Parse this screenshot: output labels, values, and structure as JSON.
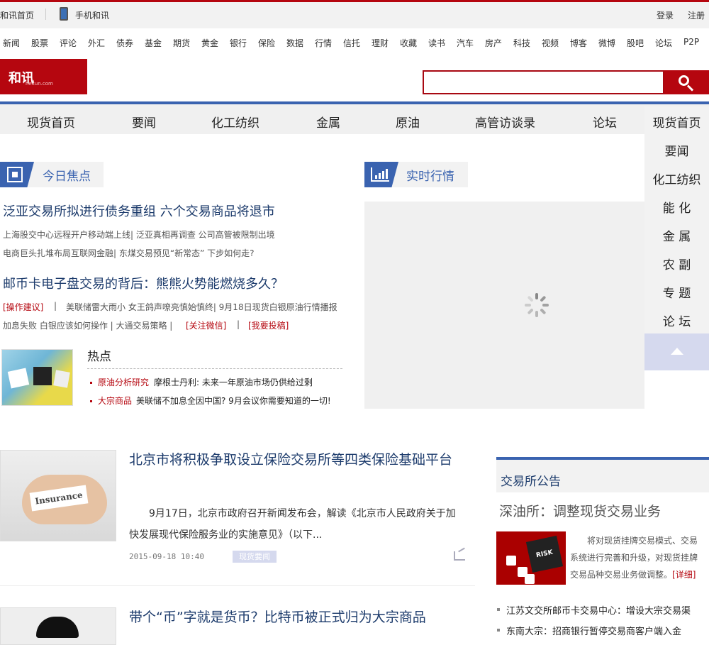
{
  "topbar": {
    "home": "和讯首页",
    "mobile": "手机和讯",
    "login": "登录",
    "register": "注册"
  },
  "channels": [
    "新闻",
    "股票",
    "评论",
    "外汇",
    "债券",
    "基金",
    "期货",
    "黄金",
    "银行",
    "保险",
    "数据",
    "行情",
    "信托",
    "理财",
    "收藏",
    "读书",
    "汽车",
    "房产",
    "科技",
    "视频",
    "博客",
    "微博",
    "股吧",
    "论坛",
    "P2P"
  ],
  "logo": {
    "mark": "和讯",
    "sub": "hexun.com"
  },
  "search": {
    "placeholder": ""
  },
  "mainnav": [
    "现货首页",
    "要闻",
    "化工纺织",
    "金属",
    "原油",
    "高管访谈录",
    "论坛"
  ],
  "floatmenu": [
    "现货首页",
    "要闻",
    "化工纺织",
    "能 化",
    "金 属",
    "农 副",
    "专 题",
    "论 坛"
  ],
  "focus": {
    "title": "今日焦点",
    "headline1": "泛亚交易所拟进行债务重组 六个交易商品将退市",
    "line1": "上海股交中心远程开户移动端上线| 泛亚真相再调查 公司高管被限制出境",
    "line2": "电商巨头扎堆布局互联网金融| 东煤交易预见“新常态” 下步如何走?",
    "headline2": "邮币卡电子盘交易的背后：熊熊火势能燃烧多久？",
    "tag_ops": "[操作建议]",
    "line3_rest": "美联储雷大雨小 女王鸽声嘹亮慎始慎终| 9月18日现货白银原油行情播报",
    "line4_rest": "加息失败 白银应该如何操作 | 大通交易策略 |",
    "tag_wechat": "[关注微信]",
    "tag_submit": "[我要投稿]",
    "bar": "|"
  },
  "hot": {
    "title": "热点",
    "items": [
      {
        "tag": "原油分析研究",
        "text": "摩根士丹利: 未来一年原油市场仍供给过剩"
      },
      {
        "tag": "大宗商品",
        "text": "美联储不加息全因中国? 9月会议你需要知道的一切!"
      }
    ]
  },
  "realtime": {
    "title": "实时行情"
  },
  "articles": [
    {
      "title": "北京市将积极争取设立保险交易所等四类保险基础平台",
      "body": "9月17日，北京市政府召开新闻发布会，解读《北京市人民政府关于加快发展现代保险服务业的实施意见》（以下...",
      "time": "2015-09-18 10:40",
      "tag": "现货要闻",
      "img_text": "Insurance"
    },
    {
      "title": "带个“币”字就是货币？比特币被正式归为大宗商品"
    }
  ],
  "announcements": {
    "title": "交易所公告",
    "headline": "深油所：调整现货交易业务",
    "img_text": "RISK",
    "body": "将对现货挂牌交易模式、交易系统进行完善和升级，对现货挂牌交易品种交易业务做调整。",
    "detail": "[详细]",
    "items": [
      "江苏文交所邮币卡交易中心：增设大宗交易渠",
      "东南大宗：招商银行暂停交易商客户端入金"
    ]
  }
}
